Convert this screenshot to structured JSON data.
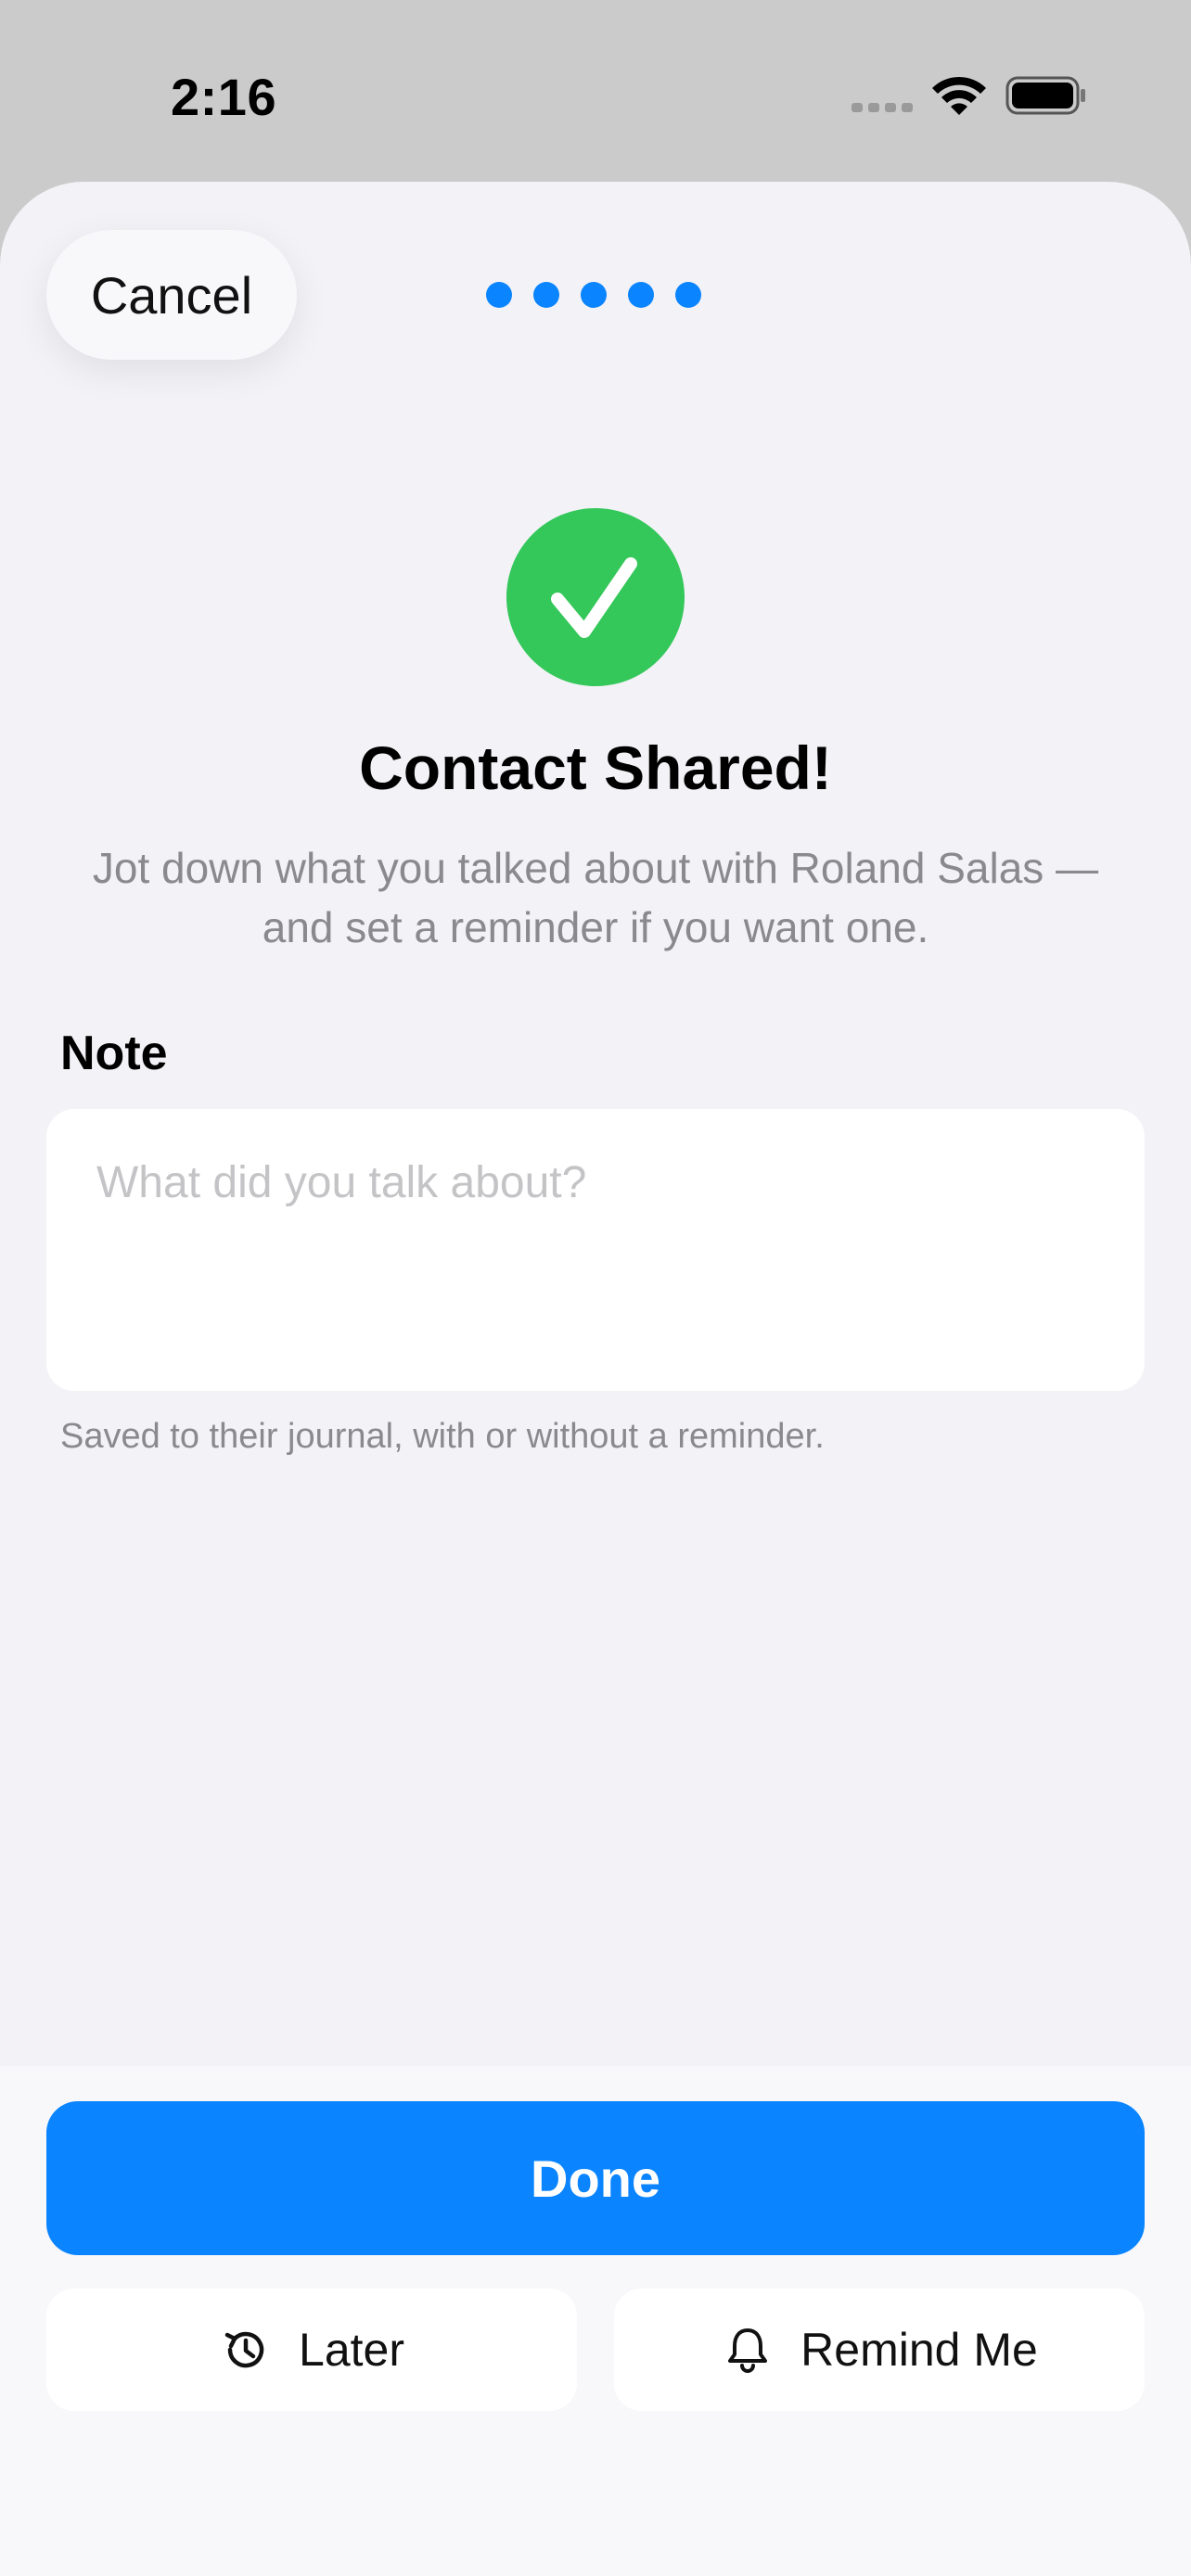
{
  "status_bar": {
    "time": "2:16"
  },
  "sheet": {
    "cancel_label": "Cancel",
    "progress_steps": 5,
    "title": "Contact Shared!",
    "subtitle_line1": "Jot down what you talked about with Roland Salas —",
    "subtitle_line2": "and set a reminder if you want one.",
    "note_label": "Note",
    "note_placeholder": "What did you talk about?",
    "note_value": "",
    "helper_text": "Saved to their journal, with or without a reminder."
  },
  "footer": {
    "done_label": "Done",
    "later_label": "Later",
    "remind_label": "Remind Me"
  },
  "colors": {
    "accent": "#0a84ff",
    "success": "#34c759",
    "background": "#f2f2f7"
  },
  "icons": {
    "check": "checkmark-circle-icon",
    "later": "clock-history-icon",
    "remind": "bell-icon"
  }
}
